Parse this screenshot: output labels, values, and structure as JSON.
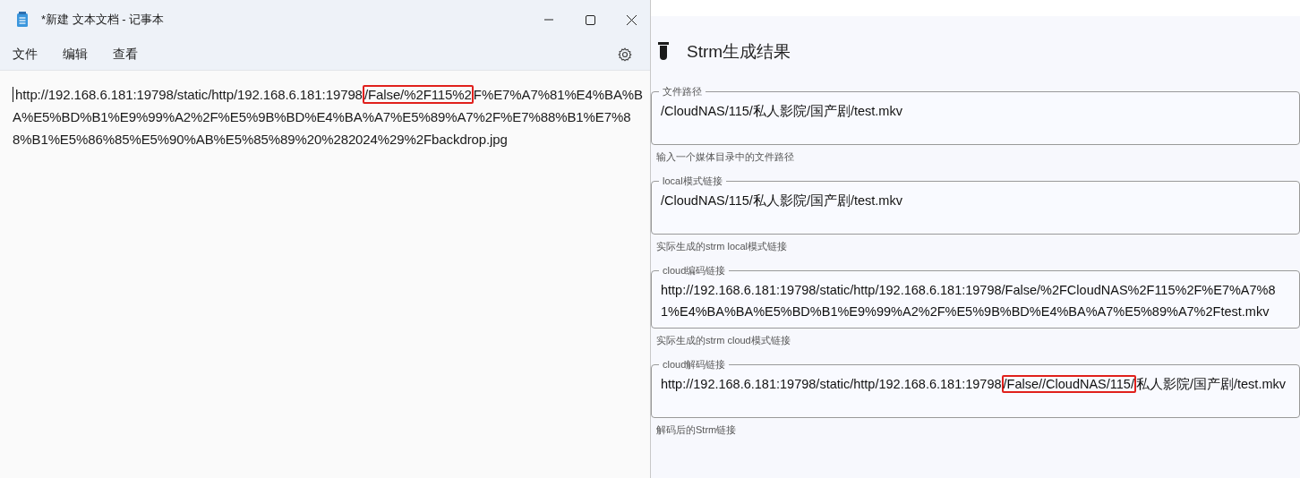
{
  "notepad": {
    "title": "*新建 文本文档 - 记事本",
    "menu": [
      "文件",
      "编辑",
      "查看"
    ],
    "content": [
      {
        "text": "http://192.168.6.181:19798/static/http/192.168.6.181:19798",
        "highlighted": false
      },
      {
        "text": "/False/%2F115%2",
        "highlighted": true
      },
      {
        "text": "F%E7%A7%81%E4%BA%BA%E5%BD%B1%E9%99%A2%2F%E5%9B%BD%E4%BA%A7%E5%89%A7%2F%E7%88%B1%E7%88%B1%E5%86%85%E5%90%AB%E5%85%89%20%282024%29%2Fbackdrop.jpg",
        "highlighted": false
      }
    ]
  },
  "panel": {
    "title": "Strm生成结果",
    "fields": [
      {
        "label": "文件路径",
        "value": "/CloudNAS/115/私人影院/国产剧/test.mkv",
        "hint": "输入一个媒体目录中的文件路径"
      },
      {
        "label": "local模式链接",
        "value": "/CloudNAS/115/私人影院/国产剧/test.mkv",
        "hint": "实际生成的strm local模式链接"
      },
      {
        "label": "cloud编码链接",
        "value": "http://192.168.6.181:19798/static/http/192.168.6.181:19798/False/%2FCloudNAS%2F115%2F%E7%A7%81%E4%BA%BA%E5%BD%B1%E9%99%A2%2F%E5%9B%BD%E4%BA%A7%E5%89%A7%2Ftest.mkv",
        "hint": "实际生成的strm cloud模式链接"
      },
      {
        "label": "cloud解码链接",
        "value": [
          {
            "text": "http://192.168.6.181:19798/static/http/192.168.6.181:19798",
            "highlighted": false
          },
          {
            "text": "/False//CloudNAS/115/",
            "highlighted": true
          },
          {
            "text": "私人影院/国产剧/test.mkv",
            "highlighted": false
          }
        ],
        "hint": "解码后的Strm链接"
      }
    ]
  }
}
